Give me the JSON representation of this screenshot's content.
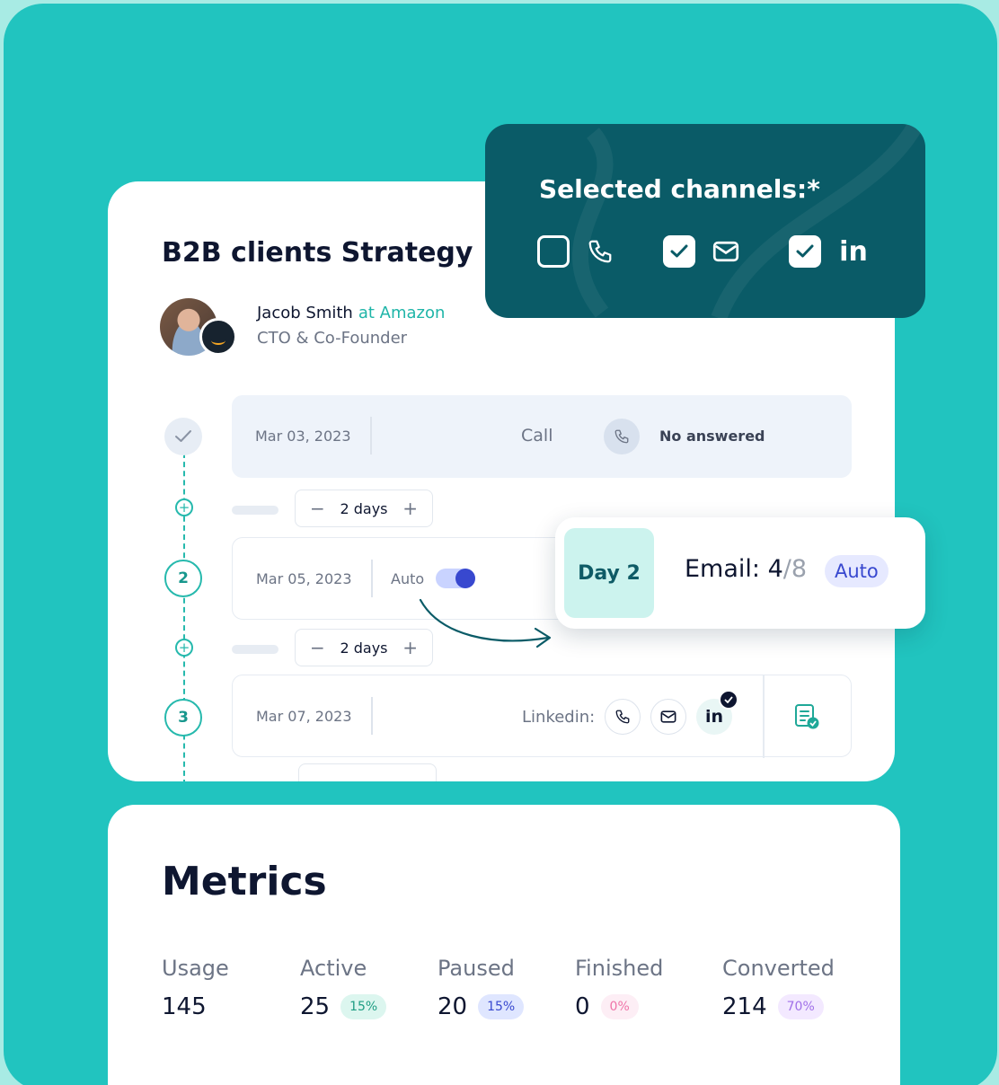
{
  "strategy": {
    "title": "B2B clients Strategy",
    "person": {
      "name": "Jacob Smith",
      "company": "at Amazon",
      "role": "CTO & Co-Founder"
    },
    "steps": [
      {
        "date": "Mar 03, 2023",
        "channel": "Call",
        "status": "No answered"
      },
      {
        "number": "2",
        "date": "Mar 05, 2023",
        "auto_label": "Auto"
      },
      {
        "number": "3",
        "date": "Mar 07, 2023",
        "channels_label": "Linkedin:",
        "linkedin_text": "in"
      }
    ],
    "delay": {
      "label": "2 days",
      "minus": "−",
      "plus": "+"
    },
    "plus_icon": "+"
  },
  "channels": {
    "title": "Selected channels:*",
    "items": [
      {
        "icon": "phone-icon",
        "checked": false
      },
      {
        "icon": "mail-icon",
        "checked": true
      },
      {
        "icon": "linkedin-icon",
        "label": "in",
        "checked": true
      }
    ]
  },
  "day_card": {
    "day": "Day 2",
    "email_label": "Email:",
    "current": "4",
    "slash": "/",
    "total": "8",
    "badge": "Auto"
  },
  "metrics": {
    "title": "Metrics",
    "items": [
      {
        "label": "Usage",
        "value": "145"
      },
      {
        "label": "Active",
        "value": "25",
        "badge": "15%"
      },
      {
        "label": "Paused",
        "value": "20",
        "badge": "15%"
      },
      {
        "label": "Finished",
        "value": "0",
        "badge": "0%"
      },
      {
        "label": "Converted",
        "value": "214",
        "badge": "70%"
      }
    ]
  },
  "colors": {
    "teal_bg": "#21c4bf",
    "dark_teal": "#0a5b67",
    "accent_teal": "#26b9ad",
    "accent_blue": "#3848cf"
  }
}
